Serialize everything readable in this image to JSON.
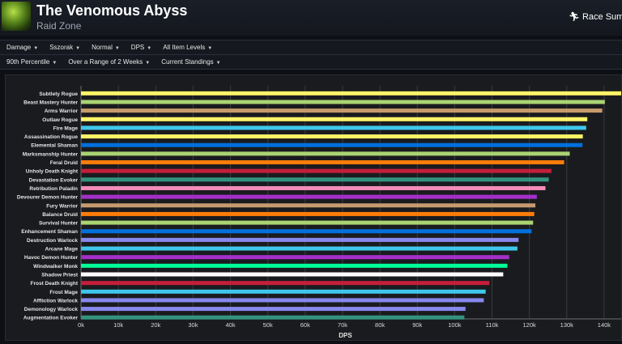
{
  "header": {
    "title": "The Venomous Abyss",
    "subtitle": "Raid Zone",
    "race_link": "Race Sum"
  },
  "filters_row1": [
    {
      "label": "Damage"
    },
    {
      "label": "Sszorak"
    },
    {
      "label": "Normal"
    },
    {
      "label": "DPS"
    },
    {
      "label": "All Item Levels"
    }
  ],
  "filters_row2": [
    {
      "label": "90th Percentile"
    },
    {
      "label": "Over a Range of 2 Weeks"
    },
    {
      "label": "Current Standings"
    }
  ],
  "chart_data": {
    "type": "bar",
    "orientation": "horizontal",
    "xlabel": "DPS",
    "xlim": [
      0,
      145000
    ],
    "xticks": [
      0,
      10000,
      20000,
      30000,
      40000,
      50000,
      60000,
      70000,
      80000,
      90000,
      100000,
      110000,
      120000,
      130000,
      140000
    ],
    "xtick_labels": [
      "0k",
      "10k",
      "20k",
      "30k",
      "40k",
      "50k",
      "60k",
      "70k",
      "80k",
      "90k",
      "100k",
      "110k",
      "120k",
      "130k",
      "140k"
    ],
    "grid": true,
    "categories": [
      "Subtlety Rogue",
      "Beast Mastery Hunter",
      "Arms Warrior",
      "Outlaw Rogue",
      "Fire Mage",
      "Assassination Rogue",
      "Elemental Shaman",
      "Marksmanship Hunter",
      "Feral Druid",
      "Unholy Death Knight",
      "Devastation Evoker",
      "Retribution Paladin",
      "Devourer Demon Hunter",
      "Fury Warrior",
      "Balance Druid",
      "Survival Hunter",
      "Enhancement Shaman",
      "Destruction Warlock",
      "Arcane Mage",
      "Havoc Demon Hunter",
      "Windwalker Monk",
      "Shadow Priest",
      "Frost Death Knight",
      "Frost Mage",
      "Affliction Warlock",
      "Demonology Warlock",
      "Augmentation Evoker"
    ],
    "values": [
      145000,
      140200,
      139500,
      135500,
      135200,
      134300,
      134200,
      130800,
      129300,
      125900,
      125200,
      124300,
      122000,
      121600,
      121300,
      121000,
      120600,
      117100,
      116800,
      114600,
      114100,
      113000,
      109300,
      108300,
      107800,
      102900,
      102600
    ],
    "colors": [
      "#FFF468",
      "#AAD372",
      "#C69B6D",
      "#FFF468",
      "#3FC7EB",
      "#FFF468",
      "#0070DD",
      "#AAD372",
      "#FF7C0A",
      "#C41E3A",
      "#33937F",
      "#F48CBA",
      "#A330C9",
      "#C69B6D",
      "#FF7C0A",
      "#AAD372",
      "#0070DD",
      "#8788EE",
      "#3FC7EB",
      "#A330C9",
      "#00FF98",
      "#FFFFFF",
      "#C41E3A",
      "#3FC7EB",
      "#8788EE",
      "#8788EE",
      "#33937F"
    ]
  }
}
